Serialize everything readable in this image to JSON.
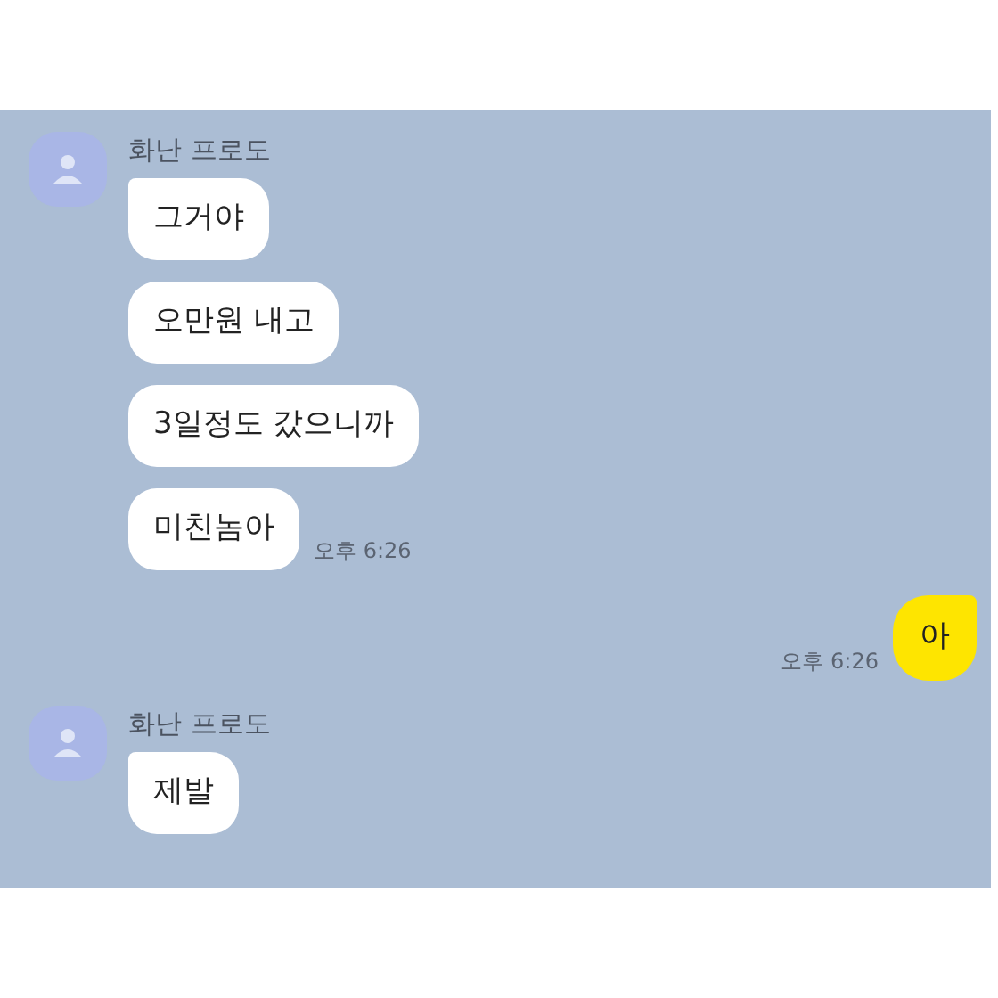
{
  "messages": [
    {
      "kind": "received",
      "sender": "화난 프로도",
      "bubbles": [
        "그거야",
        "오만원 내고",
        "3일정도 갔으니까",
        "미친놈아"
      ],
      "time": "오후 6:26"
    },
    {
      "kind": "sent",
      "bubbles": [
        "아"
      ],
      "time": "오후 6:26"
    },
    {
      "kind": "received",
      "sender": "화난 프로도",
      "bubbles": [
        "제발"
      ]
    }
  ]
}
